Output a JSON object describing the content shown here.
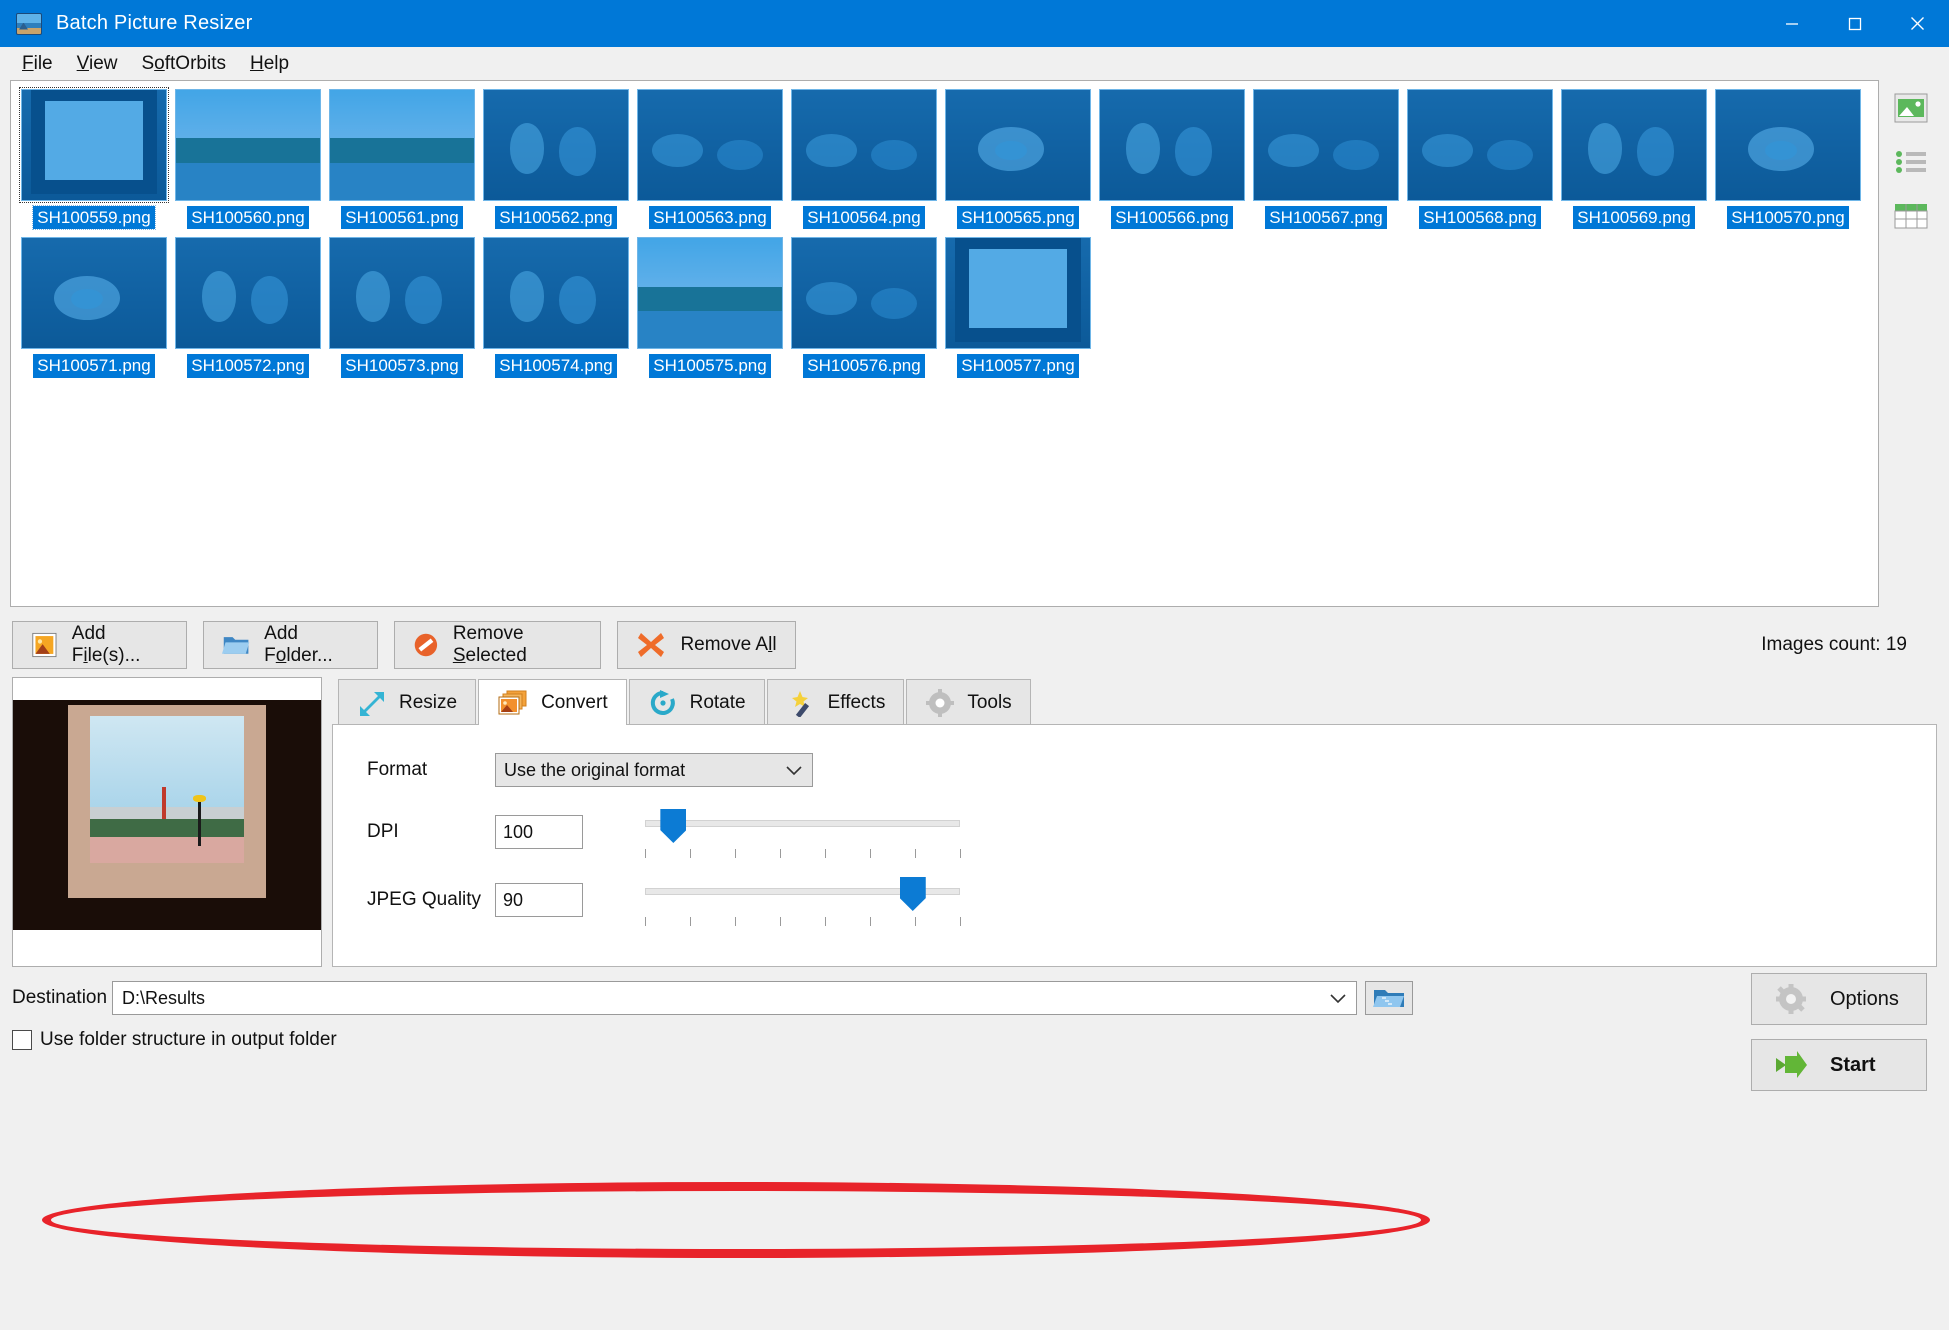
{
  "window": {
    "title": "Batch Picture Resizer",
    "app_icon": "picture-resizer-icon",
    "minimize": "minimize-icon",
    "maximize": "maximize-icon",
    "close": "close-icon"
  },
  "menubar": [
    {
      "label": "File",
      "accel": "F"
    },
    {
      "label": "View",
      "accel": "V"
    },
    {
      "label": "SoftOrbits",
      "accel": "O"
    },
    {
      "label": "Help",
      "accel": "H"
    }
  ],
  "view_modes": [
    {
      "name": "thumbnail-view-icon",
      "label": "Thumbnails"
    },
    {
      "name": "list-view-icon",
      "label": "List"
    },
    {
      "name": "details-view-icon",
      "label": "Details"
    }
  ],
  "thumbnails": [
    {
      "filename": "SH100559.png",
      "scene": "window",
      "selected": true,
      "focused": true
    },
    {
      "filename": "SH100560.png",
      "scene": "outdoor",
      "selected": true,
      "focused": false
    },
    {
      "filename": "SH100561.png",
      "scene": "outdoor",
      "selected": true,
      "focused": false
    },
    {
      "filename": "SH100562.png",
      "scene": "people",
      "selected": true,
      "focused": false
    },
    {
      "filename": "SH100563.png",
      "scene": "indoor",
      "selected": true,
      "focused": false
    },
    {
      "filename": "SH100564.png",
      "scene": "indoor",
      "selected": true,
      "focused": false
    },
    {
      "filename": "SH100565.png",
      "scene": "food",
      "selected": true,
      "focused": false
    },
    {
      "filename": "SH100566.png",
      "scene": "people",
      "selected": true,
      "focused": false
    },
    {
      "filename": "SH100567.png",
      "scene": "indoor",
      "selected": true,
      "focused": false
    },
    {
      "filename": "SH100568.png",
      "scene": "indoor",
      "selected": true,
      "focused": false
    },
    {
      "filename": "SH100569.png",
      "scene": "people",
      "selected": true,
      "focused": false
    },
    {
      "filename": "SH100570.png",
      "scene": "food",
      "selected": true,
      "focused": false
    },
    {
      "filename": "SH100571.png",
      "scene": "food",
      "selected": true,
      "focused": false
    },
    {
      "filename": "SH100572.png",
      "scene": "people",
      "selected": true,
      "focused": false
    },
    {
      "filename": "SH100573.png",
      "scene": "people",
      "selected": true,
      "focused": false
    },
    {
      "filename": "SH100574.png",
      "scene": "people",
      "selected": true,
      "focused": false
    },
    {
      "filename": "SH100575.png",
      "scene": "outdoor",
      "selected": true,
      "focused": false
    },
    {
      "filename": "SH100576.png",
      "scene": "indoor",
      "selected": true,
      "focused": false
    },
    {
      "filename": "SH100577.png",
      "scene": "window",
      "selected": true,
      "focused": false
    }
  ],
  "actions": {
    "add_files": {
      "label_pre": "Add F",
      "accel": "i",
      "label_post": "le(s)...",
      "icon": "add-file-icon"
    },
    "add_folder": {
      "label_pre": "Add F",
      "accel": "o",
      "label_post": "lder...",
      "icon": "add-folder-icon"
    },
    "remove_selected": {
      "label_pre": "Remove ",
      "accel": "S",
      "label_post": "elected",
      "icon": "remove-selected-icon"
    },
    "remove_all": {
      "label_pre": "Remove A",
      "accel": "l",
      "label_post": "l",
      "icon": "remove-all-icon"
    },
    "images_count": "Images count: 19"
  },
  "tabs": [
    {
      "label": "Resize",
      "icon": "resize-arrows-icon",
      "active": false
    },
    {
      "label": "Convert",
      "icon": "convert-images-icon",
      "active": true
    },
    {
      "label": "Rotate",
      "icon": "rotate-icon",
      "active": false
    },
    {
      "label": "Effects",
      "icon": "magic-wand-icon",
      "active": false
    },
    {
      "label": "Tools",
      "icon": "gear-icon",
      "active": false
    }
  ],
  "convert": {
    "format_label": "Format",
    "format_value": "Use the original format",
    "dpi_label": "DPI",
    "dpi_value": "100",
    "dpi_slider_percent": 9,
    "jpeg_label": "JPEG Quality",
    "jpeg_value": "90",
    "jpeg_slider_percent": 85
  },
  "destination": {
    "label": "Destination",
    "value": "D:\\Results",
    "browse_icon": "browse-folder-icon",
    "checkbox_label": "Use folder structure in output folder",
    "checkbox_checked": false
  },
  "footer_buttons": {
    "options": {
      "label": "Options",
      "icon": "gear-icon"
    },
    "start": {
      "label": "Start",
      "icon": "green-arrow-icon"
    }
  },
  "annotation": {
    "shape": "red-ellipse",
    "color": "#e8232a"
  },
  "colors": {
    "title_bar": "#0078d7",
    "accent": "#0078d7",
    "window_bg": "#f0f0f0",
    "annotation_red": "#e8232a",
    "slider_blue": "#0c7bd4"
  }
}
